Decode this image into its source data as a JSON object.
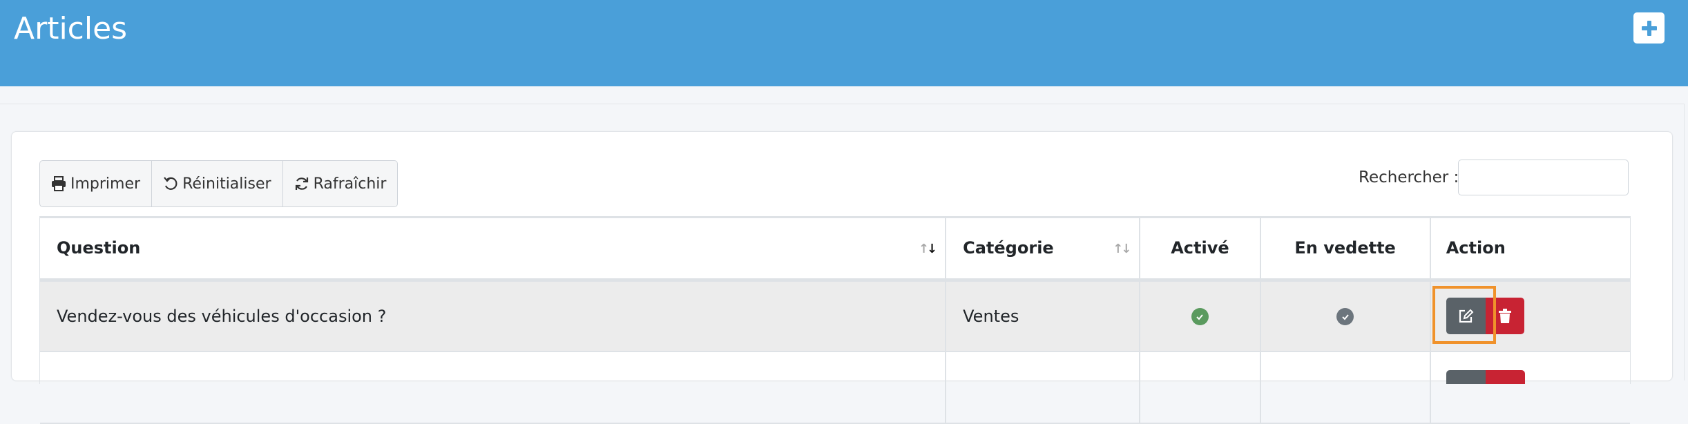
{
  "header": {
    "title": "Articles",
    "add_button_label": "+"
  },
  "toolbar": {
    "buttons": [
      {
        "label": "Imprimer",
        "icon": "printer-icon"
      },
      {
        "label": "Réinitialiser",
        "icon": "undo-icon"
      },
      {
        "label": "Rafraîchir",
        "icon": "refresh-icon"
      }
    ]
  },
  "search": {
    "label": "Rechercher :",
    "value": ""
  },
  "table": {
    "columns": [
      "Question",
      "Catégorie",
      "Activé",
      "En vedette",
      "Action"
    ],
    "rows": [
      {
        "question": "Vendez-vous des véhicules d'occasion ?",
        "categorie": "Ventes",
        "active": true,
        "vedette": true
      }
    ]
  },
  "colors": {
    "header_bg": "#4a9fd9",
    "active_check": "#5a9a5e",
    "vedette_check": "#6c757d",
    "edit_btn": "#5a6268",
    "delete_btn": "#c82333",
    "highlight": "#f0922b"
  }
}
